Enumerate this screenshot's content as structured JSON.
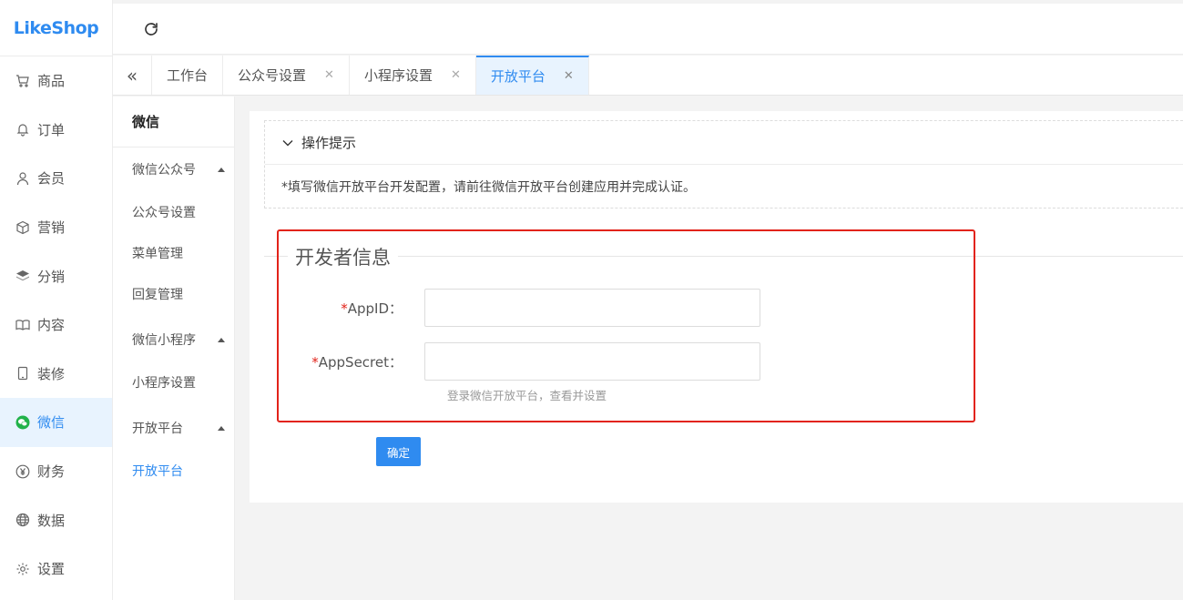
{
  "logo": "LikeShop",
  "colors": {
    "accent": "#2f8bf0",
    "highlight": "#e2231a"
  },
  "sidebar": {
    "items": [
      {
        "label": "商品",
        "icon": "cart-icon"
      },
      {
        "label": "订单",
        "icon": "bell-icon"
      },
      {
        "label": "会员",
        "icon": "user-icon"
      },
      {
        "label": "营销",
        "icon": "cube-icon"
      },
      {
        "label": "分销",
        "icon": "layers-icon"
      },
      {
        "label": "内容",
        "icon": "book-icon"
      },
      {
        "label": "装修",
        "icon": "phone-icon"
      },
      {
        "label": "微信",
        "icon": "wechat-icon",
        "active": true
      },
      {
        "label": "财务",
        "icon": "yen-icon"
      },
      {
        "label": "数据",
        "icon": "globe-icon"
      },
      {
        "label": "设置",
        "icon": "gear-icon"
      }
    ]
  },
  "tabs": [
    {
      "label": "工作台",
      "closable": false
    },
    {
      "label": "公众号设置",
      "closable": true
    },
    {
      "label": "小程序设置",
      "closable": true
    },
    {
      "label": "开放平台",
      "closable": true,
      "active": true
    }
  ],
  "submenu": {
    "title": "微信",
    "groups": [
      {
        "label": "微信公众号",
        "items": [
          "公众号设置",
          "菜单管理",
          "回复管理"
        ]
      },
      {
        "label": "微信小程序",
        "items": [
          "小程序设置"
        ]
      },
      {
        "label": "开放平台",
        "items": [
          "开放平台"
        ]
      }
    ],
    "active_item": "开放平台"
  },
  "tips": {
    "title": "操作提示",
    "body": "*填写微信开放平台开发配置，请前往微信开放平台创建应用并完成认证。"
  },
  "form": {
    "legend": "开发者信息",
    "appid_label": "AppID：",
    "appid_value": "",
    "appsecret_label": "AppSecret：",
    "appsecret_value": "",
    "helper": "登录微信开放平台，查看并设置",
    "submit": "确定"
  }
}
